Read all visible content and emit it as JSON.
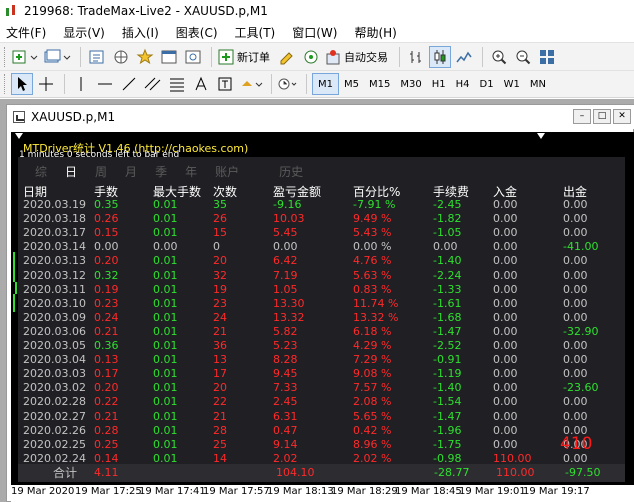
{
  "window": {
    "title": "219968: TradeMax-Live2 - XAUUSD.p,M1"
  },
  "menu": [
    "文件(F)",
    "显示(V)",
    "插入(I)",
    "图表(C)",
    "工具(T)",
    "窗口(W)",
    "帮助(H)"
  ],
  "toolbar": {
    "new_order_label": "新订单",
    "autotrade_label": "自动交易",
    "timeframes": [
      "M1",
      "M5",
      "M15",
      "M30",
      "H1",
      "H4",
      "D1",
      "W1",
      "MN"
    ],
    "active_timeframe": "M1"
  },
  "chart_window": {
    "title": "XAUUSD.p,M1"
  },
  "indicator": {
    "title": "MTDriver统计 V1.46  (http://chaokes.com)",
    "subtitle": "1 minutes 0 seconds left to bar end"
  },
  "tabs": [
    "综",
    "日",
    "周",
    "月",
    "季",
    "年",
    "账户",
    "历史"
  ],
  "active_tab": "日",
  "table": {
    "headers": [
      "日期",
      "手数",
      "最大手数",
      "次数",
      "盈亏金额",
      "百分比%",
      "手续费",
      "入金",
      "出金"
    ],
    "rows": [
      [
        "2020.03.19",
        "0.35",
        "0.01",
        "35",
        "-9.16",
        "-7.91 %",
        "-2.45",
        "0.00",
        "0.00"
      ],
      [
        "2020.03.18",
        "0.26",
        "0.01",
        "26",
        "10.03",
        "9.49 %",
        "-1.82",
        "0.00",
        "0.00"
      ],
      [
        "2020.03.17",
        "0.15",
        "0.01",
        "15",
        "5.45",
        "5.43 %",
        "-1.05",
        "0.00",
        "0.00"
      ],
      [
        "2020.03.14",
        "0.00",
        "0.00",
        "0",
        "0.00",
        "0.00 %",
        "0.00",
        "0.00",
        "-41.00"
      ],
      [
        "2020.03.13",
        "0.20",
        "0.01",
        "20",
        "6.42",
        "4.76 %",
        "-1.40",
        "0.00",
        "0.00"
      ],
      [
        "2020.03.12",
        "0.32",
        "0.01",
        "32",
        "7.19",
        "5.63 %",
        "-2.24",
        "0.00",
        "0.00"
      ],
      [
        "2020.03.11",
        "0.19",
        "0.01",
        "19",
        "1.05",
        "0.83 %",
        "-1.33",
        "0.00",
        "0.00"
      ],
      [
        "2020.03.10",
        "0.23",
        "0.01",
        "23",
        "13.30",
        "11.74 %",
        "-1.61",
        "0.00",
        "0.00"
      ],
      [
        "2020.03.09",
        "0.24",
        "0.01",
        "24",
        "13.32",
        "13.32 %",
        "-1.68",
        "0.00",
        "0.00"
      ],
      [
        "2020.03.06",
        "0.21",
        "0.01",
        "21",
        "5.82",
        "6.18 %",
        "-1.47",
        "0.00",
        "-32.90"
      ],
      [
        "2020.03.05",
        "0.36",
        "0.01",
        "36",
        "5.23",
        "4.29 %",
        "-2.52",
        "0.00",
        "0.00"
      ],
      [
        "2020.03.04",
        "0.13",
        "0.01",
        "13",
        "8.28",
        "7.29 %",
        "-0.91",
        "0.00",
        "0.00"
      ],
      [
        "2020.03.03",
        "0.17",
        "0.01",
        "17",
        "9.45",
        "9.08 %",
        "-1.19",
        "0.00",
        "0.00"
      ],
      [
        "2020.03.02",
        "0.20",
        "0.01",
        "20",
        "7.33",
        "7.57 %",
        "-1.40",
        "0.00",
        "-23.60"
      ],
      [
        "2020.02.28",
        "0.22",
        "0.01",
        "22",
        "2.45",
        "2.08 %",
        "-1.54",
        "0.00",
        "0.00"
      ],
      [
        "2020.02.27",
        "0.21",
        "0.01",
        "21",
        "6.31",
        "5.65 %",
        "-1.47",
        "0.00",
        "0.00"
      ],
      [
        "2020.02.26",
        "0.28",
        "0.01",
        "28",
        "0.47",
        "0.42 %",
        "-1.96",
        "0.00",
        "0.00"
      ],
      [
        "2020.02.25",
        "0.25",
        "0.01",
        "25",
        "9.14",
        "8.96 %",
        "-1.75",
        "0.00",
        "0.00"
      ],
      [
        "2020.02.24",
        "0.14",
        "0.01",
        "14",
        "2.02",
        "2.02 %",
        "-0.98",
        "110.00",
        "0.00"
      ]
    ],
    "total": {
      "label": "合计",
      "lots": "4.11",
      "pnl": "104.10",
      "fee": "-28.77",
      "deposit": "110.00",
      "withdraw": "-97.50"
    }
  },
  "overlay_number": "410",
  "time_axis": [
    "19 Mar 2020",
    "19 Mar 17:25",
    "19 Mar 17:41",
    "19 Mar 17:57",
    "19 Mar 18:13",
    "19 Mar 18:29",
    "19 Mar 18:45",
    "19 Mar 19:01",
    "19 Mar 19:17"
  ],
  "colors": {
    "positive": "#2fe02f",
    "negative": "#ff2a2a",
    "neutral": "#c3c3c3",
    "header": "#ffffff",
    "title": "#ffeb3b"
  }
}
